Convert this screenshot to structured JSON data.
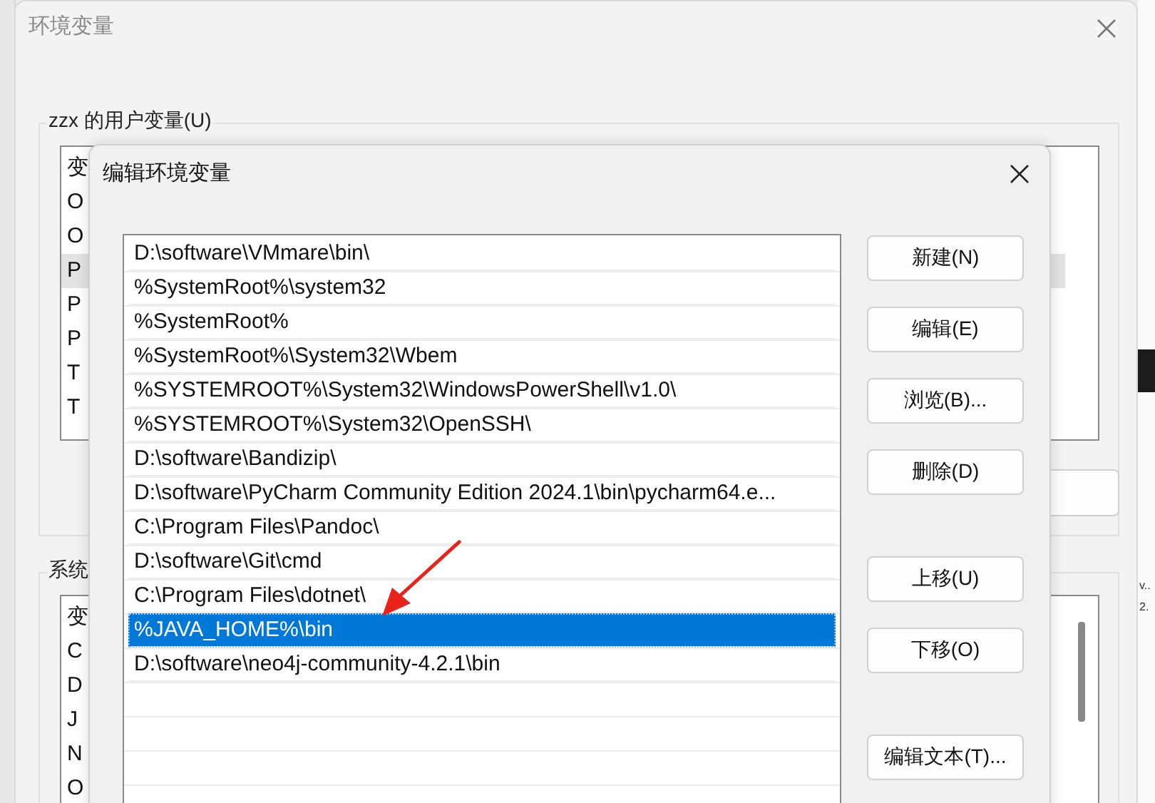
{
  "background_window": {
    "title": "环境变量",
    "user_group": {
      "label": "zzx 的用户变量(U)",
      "items": [
        {
          "text": "变",
          "selected": false
        },
        {
          "text": "O",
          "selected": false
        },
        {
          "text": "O",
          "selected": false
        },
        {
          "text": "P",
          "selected": true
        },
        {
          "text": "P",
          "selected": false
        },
        {
          "text": "P",
          "selected": false
        },
        {
          "text": "T",
          "selected": false
        },
        {
          "text": "T",
          "selected": false
        }
      ]
    },
    "system_group": {
      "label": "系统",
      "items": [
        {
          "text": "变",
          "selected": false
        },
        {
          "text": "C",
          "selected": false
        },
        {
          "text": "D",
          "selected": false
        },
        {
          "text": "J",
          "selected": false
        },
        {
          "text": "N",
          "selected": false
        },
        {
          "text": "O",
          "selected": false
        }
      ]
    }
  },
  "side_window": {
    "texts": [
      "v..",
      "2."
    ]
  },
  "dialog": {
    "title": "编辑环境变量",
    "paths": [
      {
        "text": "D:\\software\\VMmare\\bin\\",
        "selected": false
      },
      {
        "text": "%SystemRoot%\\system32",
        "selected": false
      },
      {
        "text": "%SystemRoot%",
        "selected": false
      },
      {
        "text": "%SystemRoot%\\System32\\Wbem",
        "selected": false
      },
      {
        "text": "%SYSTEMROOT%\\System32\\WindowsPowerShell\\v1.0\\",
        "selected": false
      },
      {
        "text": "%SYSTEMROOT%\\System32\\OpenSSH\\",
        "selected": false
      },
      {
        "text": "D:\\software\\Bandizip\\",
        "selected": false
      },
      {
        "text": "D:\\software\\PyCharm Community Edition 2024.1\\bin\\pycharm64.e...",
        "selected": false
      },
      {
        "text": "C:\\Program Files\\Pandoc\\",
        "selected": false
      },
      {
        "text": "D:\\software\\Git\\cmd",
        "selected": false
      },
      {
        "text": "C:\\Program Files\\dotnet\\",
        "selected": false
      },
      {
        "text": "%JAVA_HOME%\\bin",
        "selected": true
      },
      {
        "text": "D:\\software\\neo4j-community-4.2.1\\bin",
        "selected": false
      }
    ],
    "button_groups": [
      [
        "新建(N)",
        "编辑(E)",
        "浏览(B)...",
        "删除(D)"
      ],
      [
        "上移(U)",
        "下移(O)"
      ],
      [
        "编辑文本(T)..."
      ]
    ]
  },
  "annotation": {
    "kind": "arrow"
  }
}
